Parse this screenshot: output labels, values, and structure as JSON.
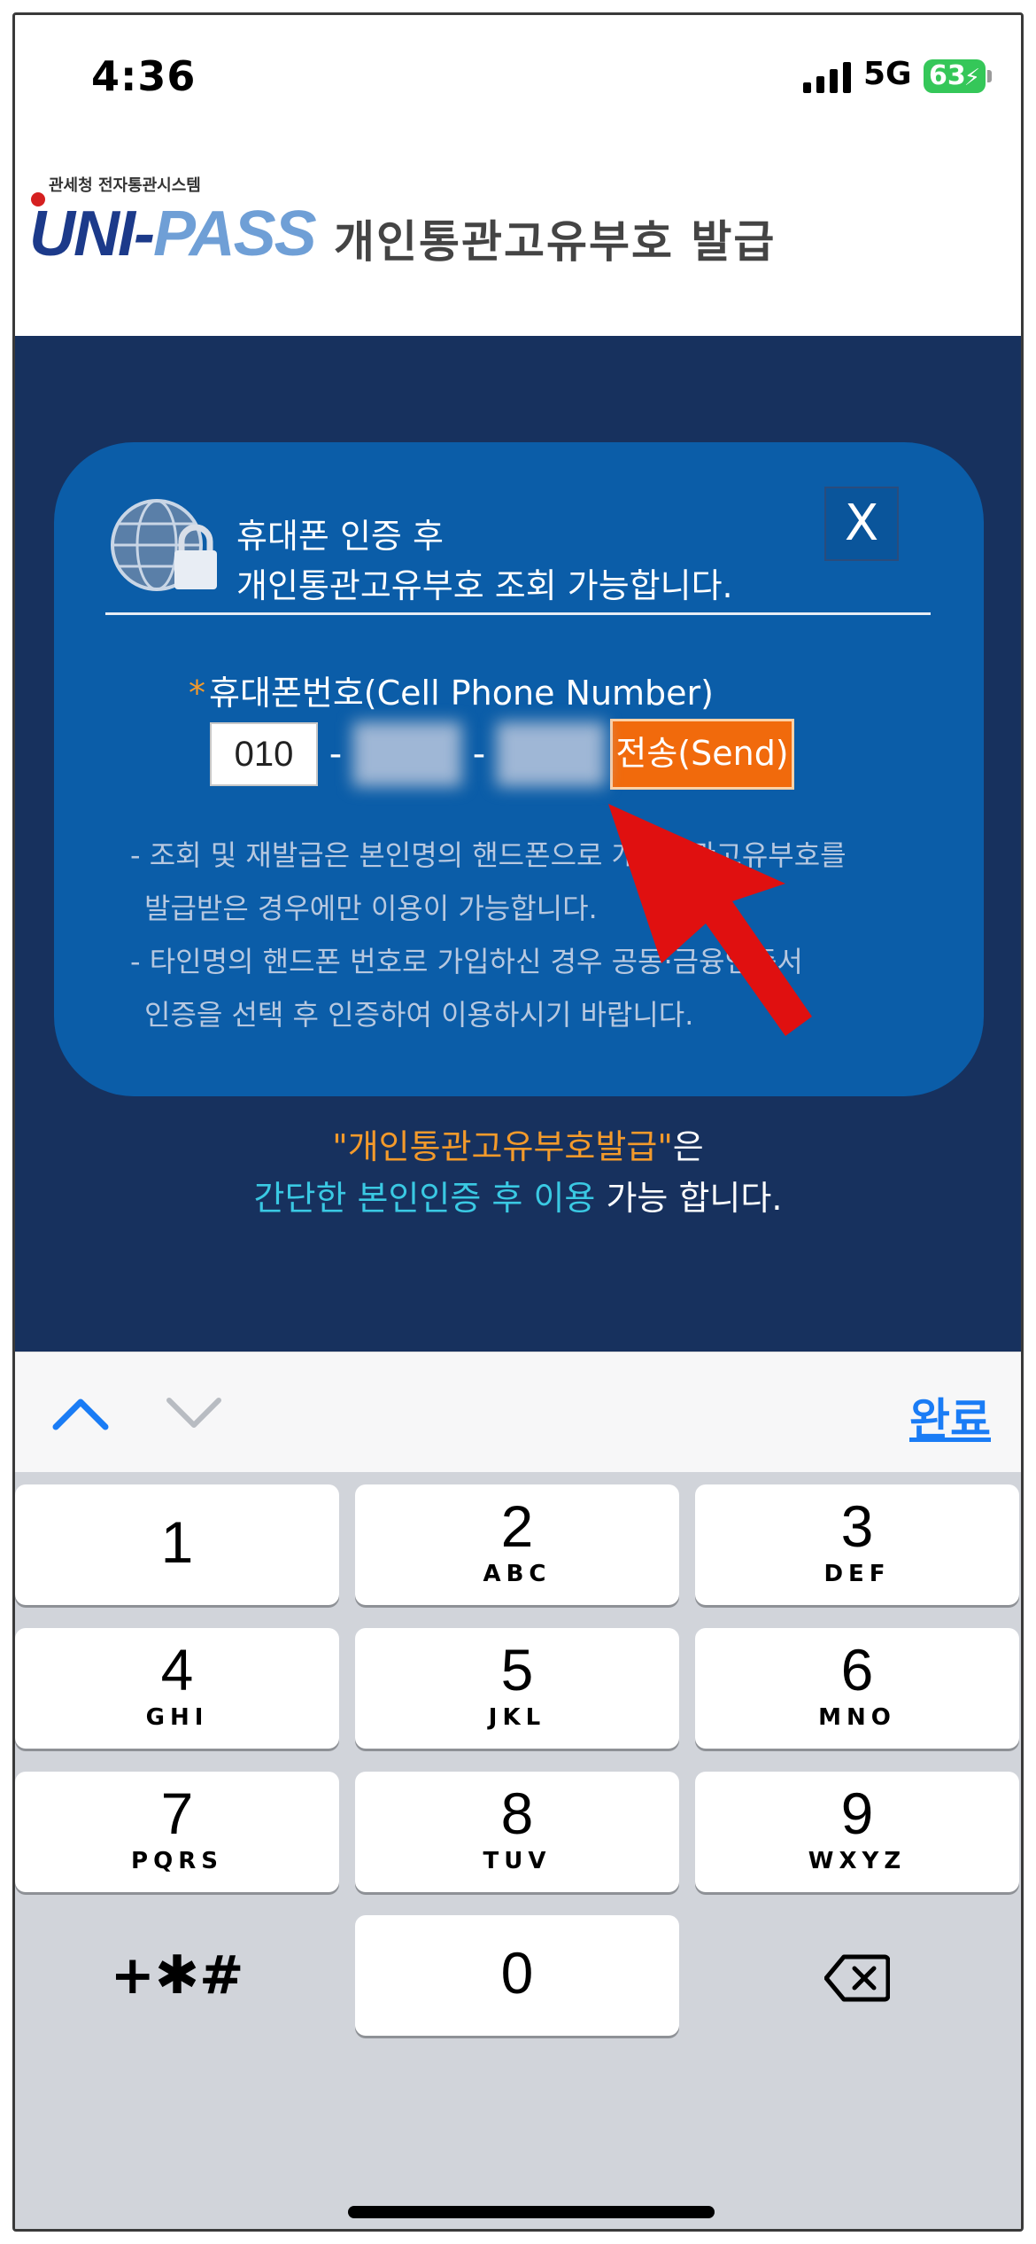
{
  "status_bar": {
    "time": "4:36",
    "network": "5G",
    "battery": "63"
  },
  "header": {
    "logo_small_text": "관세청 전자통관시스템",
    "logo_text_a": "UNI-",
    "logo_text_b": "PASS",
    "title": "개인통관고유부호 발급"
  },
  "modal": {
    "title_line1": "휴대폰 인증 후",
    "title_line2": "개인통관고유부호 조회 가능합니다.",
    "close_label": "X",
    "phone_label": "휴대폰번호(Cell Phone Number)",
    "required_mark": "*",
    "phone_prefix_value": "010",
    "dash1": "-",
    "dash2": "-",
    "send_label": "전송(Send)",
    "notice1_line1": "- 조회 및 재발급은 본인명의 핸드폰으로 개인통관고유부호를",
    "notice1_line2": "발급받은 경우에만 이용이 가능합니다.",
    "notice2_line1": "- 타인명의 핸드폰 번호로 가입하신 경우 공동·금융인증서",
    "notice2_line2": "인증을 선택 후 인증하여 이용하시기 바랍니다."
  },
  "below_text": {
    "part1": "\"개인통관고유부호발급\"",
    "part2": "은",
    "part3": "간단한 본인인증 후 이용",
    "part4": " 가능 합니다."
  },
  "keyboard_toolbar": {
    "done_label": "완료"
  },
  "keypad": {
    "keys": [
      {
        "num": "1",
        "letters": ""
      },
      {
        "num": "2",
        "letters": "ABC"
      },
      {
        "num": "3",
        "letters": "DEF"
      },
      {
        "num": "4",
        "letters": "GHI"
      },
      {
        "num": "5",
        "letters": "JKL"
      },
      {
        "num": "6",
        "letters": "MNO"
      },
      {
        "num": "7",
        "letters": "PQRS"
      },
      {
        "num": "8",
        "letters": "TUV"
      },
      {
        "num": "9",
        "letters": "WXYZ"
      },
      {
        "num": "0",
        "letters": ""
      }
    ],
    "symbols_label": "+✱#"
  },
  "colors": {
    "overlay": "#17315e",
    "modal": "#0b5da8",
    "send_button": "#f16a0c",
    "accent_orange": "#f39a2b",
    "accent_cyan": "#3ac9e3",
    "done_blue": "#1a7cf5",
    "arrow_red": "#e01010"
  },
  "icons": [
    "globe-lock-icon",
    "close-icon",
    "chevron-up-icon",
    "chevron-down-icon",
    "backspace-icon",
    "red-arrow-annotation"
  ]
}
